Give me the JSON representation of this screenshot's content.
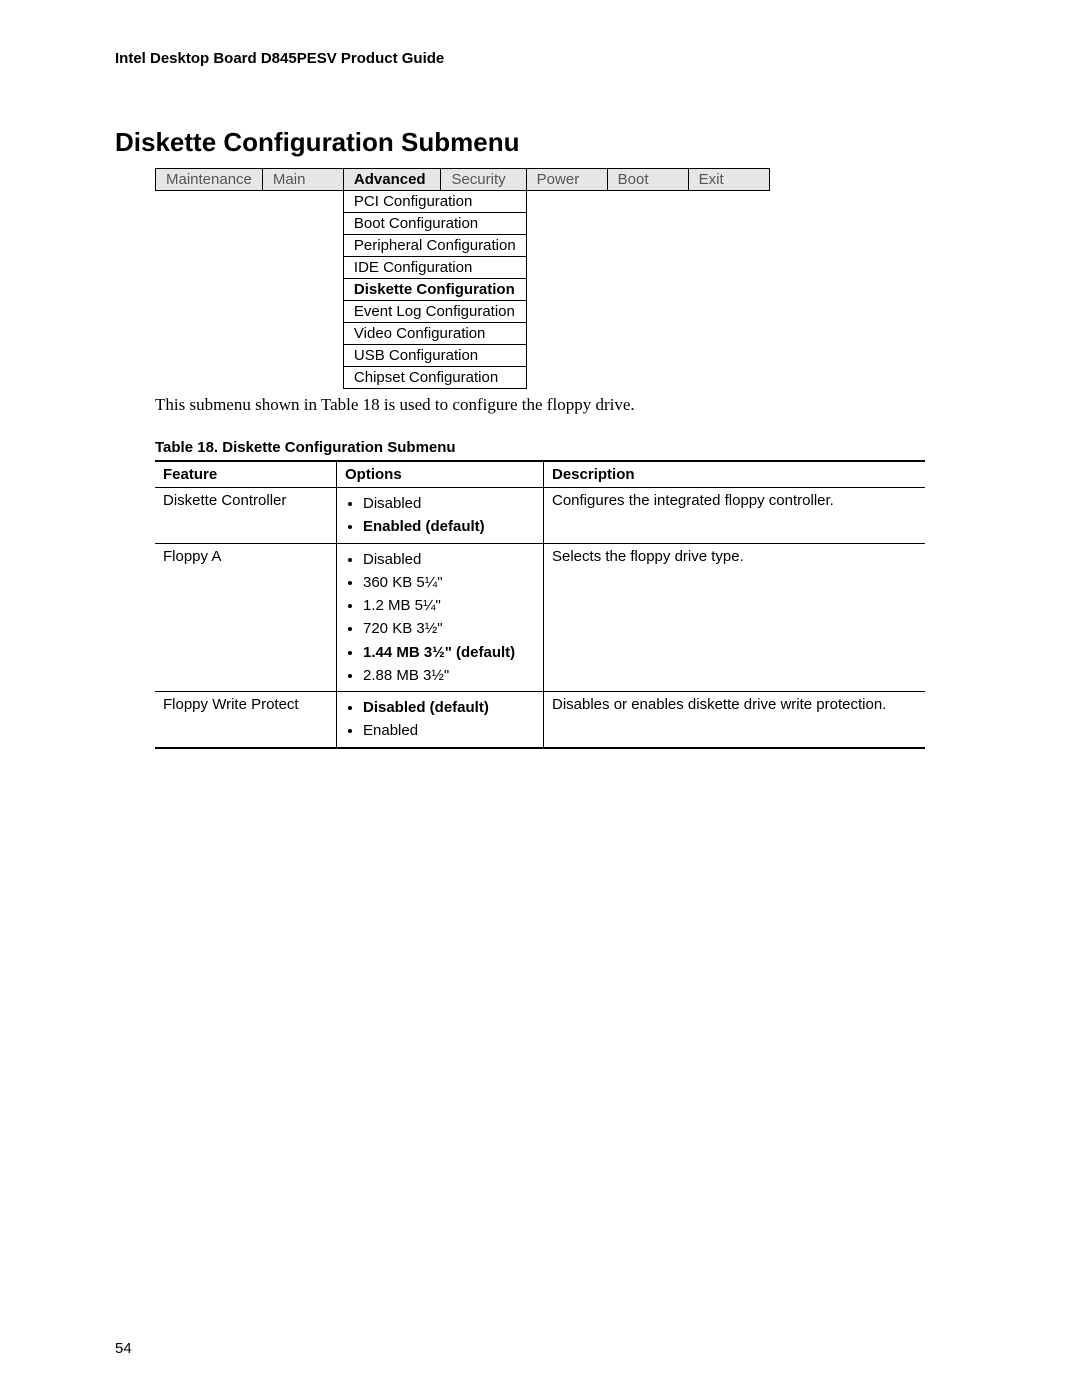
{
  "header": "Intel Desktop Board D845PESV Product Guide",
  "title": "Diskette Configuration Submenu",
  "tabs": [
    {
      "label": "Maintenance",
      "active": false
    },
    {
      "label": "Main",
      "active": false
    },
    {
      "label": "Advanced",
      "active": true
    },
    {
      "label": "Security",
      "active": false
    },
    {
      "label": "Power",
      "active": false
    },
    {
      "label": "Boot",
      "active": false
    },
    {
      "label": "Exit",
      "active": false
    }
  ],
  "submenu": [
    {
      "label": "PCI Configuration",
      "bold": false
    },
    {
      "label": "Boot Configuration",
      "bold": false
    },
    {
      "label": "Peripheral Configuration",
      "bold": false
    },
    {
      "label": "IDE Configuration",
      "bold": false
    },
    {
      "label": "Diskette Configuration",
      "bold": true
    },
    {
      "label": "Event Log Configuration",
      "bold": false
    },
    {
      "label": "Video Configuration",
      "bold": false
    },
    {
      "label": "USB Configuration",
      "bold": false
    },
    {
      "label": "Chipset Configuration",
      "bold": false
    }
  ],
  "body_text": "This submenu shown in Table 18 is used to configure the floppy drive.",
  "table_caption": "Table 18.    Diskette Configuration Submenu",
  "feature_table": {
    "headers": {
      "feature": "Feature",
      "options": "Options",
      "description": "Description"
    },
    "rows": [
      {
        "feature": "Diskette Controller",
        "options": [
          {
            "text": "Disabled",
            "bold": false
          },
          {
            "text": "Enabled (default)",
            "bold": true
          }
        ],
        "description": "Configures the integrated floppy controller."
      },
      {
        "feature": "Floppy A",
        "options": [
          {
            "text": "Disabled",
            "bold": false
          },
          {
            "text": "360 KB 5¼\"",
            "bold": false
          },
          {
            "text": "1.2 MB  5¼\"",
            "bold": false
          },
          {
            "text": "720 KB 3½\"",
            "bold": false
          },
          {
            "text": "1.44 MB 3½\" (default)",
            "bold": true
          },
          {
            "text": "2.88 MB 3½\"",
            "bold": false
          }
        ],
        "description": "Selects the floppy drive type."
      },
      {
        "feature": "Floppy Write Protect",
        "options": [
          {
            "text": "Disabled (default)",
            "bold": true
          },
          {
            "text": "Enabled",
            "bold": false
          }
        ],
        "description": "Disables or enables diskette drive write protection."
      }
    ]
  },
  "page_number": "54"
}
